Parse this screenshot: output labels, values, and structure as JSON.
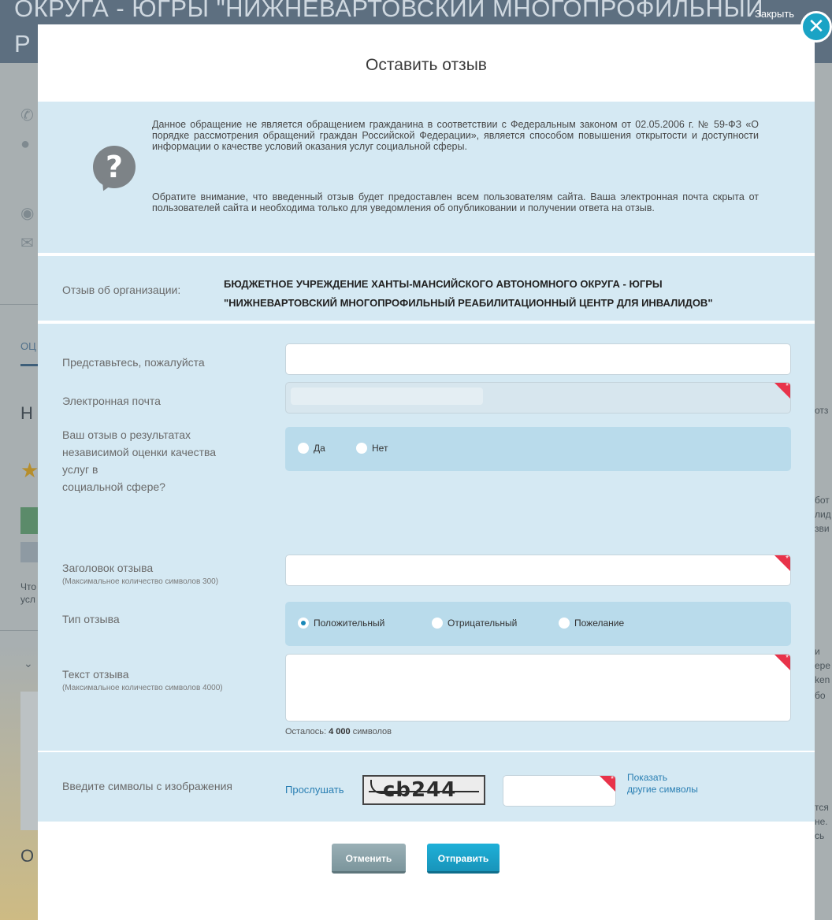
{
  "background_page": {
    "title_line1": "ОКРУГА - ЮГРЫ \"НИЖНЕВАРТОВСКИЙ МНОГОПРОФИЛЬНЫЙ",
    "title_line2": "Р",
    "close_link": "Закрыть",
    "tab_label": "ОЦ",
    "heading_letter": "Н",
    "small_text_1": "Что",
    "small_text_2": "усл",
    "bottom_letter": "О",
    "right_texts": [
      "отз",
      "бот",
      "лид",
      "зви",
      "и",
      "ере",
      "ken",
      "бо",
      "тся",
      "не.",
      "сь"
    ]
  },
  "modal": {
    "title": "Оставить отзыв",
    "info_paragraph_1": "Данное обращение не является обращением гражданина в соответствии с Федеральным законом от 02.05.2006 г. № 59-ФЗ «О порядке рассмотрения обращений граждан Российской Федерации», является способом повышения открытости и доступности информации о качестве условий оказания услуг социальной сферы.",
    "info_paragraph_2": "Обратите внимание, что введенный отзыв будет предоставлен всем пользователям сайта. Ваша электронная почта скрыта от пользователей сайта и необходима только для уведомления об опубликовании и получении ответа на отзыв.",
    "org_label": "Отзыв об организации:",
    "org_name_line1": "БЮДЖЕТНОЕ УЧРЕЖДЕНИЕ ХАНТЫ-МАНСИЙСКОГО АВТОНОМНОГО ОКРУГА - ЮГРЫ",
    "org_name_line2": "\"НИЖНЕВАРТОВСКИЙ МНОГОПРОФИЛЬНЫЙ РЕАБИЛИТАЦИОННЫЙ ЦЕНТР ДЛЯ ИНВАЛИДОВ\"",
    "fields": {
      "name_label": "Представьтесь, пожалуйста",
      "name_value": "",
      "email_label": "Электронная почта",
      "independent_label_1": "Ваш отзыв о результатах",
      "independent_label_2": "независимой оценки качества",
      "independent_label_3": "услуг в",
      "independent_label_4": "социальной сфере?",
      "independent_yes": "Да",
      "independent_no": "Нет",
      "review_title_label": "Заголовок отзыва",
      "review_title_hint": "(Максимальное количество символов 300)",
      "review_title_value": "",
      "type_label": "Тип отзыва",
      "type_positive": "Положительный",
      "type_negative": "Отрицательный",
      "type_wish": "Пожелание",
      "type_selected": "Положительный",
      "text_label": "Текст отзыва",
      "text_hint": "(Максимальное количество символов 4000)",
      "text_value": "",
      "remaining_prefix": "Осталось:",
      "remaining_count": "4 000",
      "remaining_suffix": "символов",
      "required_mark": "*"
    },
    "captcha": {
      "label": "Введите символы с изображения",
      "listen": "Прослушать",
      "image_text": "cb244",
      "value": "",
      "other_line1": "Показать",
      "other_line2": "другие символы"
    },
    "buttons": {
      "cancel": "Отменить",
      "send": "Отправить"
    }
  },
  "close_symbol": "✕",
  "colors": {
    "accent": "#1aa3c5",
    "panel": "#d5e9f3",
    "radio_bar": "#b9dbeb",
    "required": "#e8334a",
    "cancel_button": "#8aa3aa",
    "send_button": "#1aa3cc"
  }
}
